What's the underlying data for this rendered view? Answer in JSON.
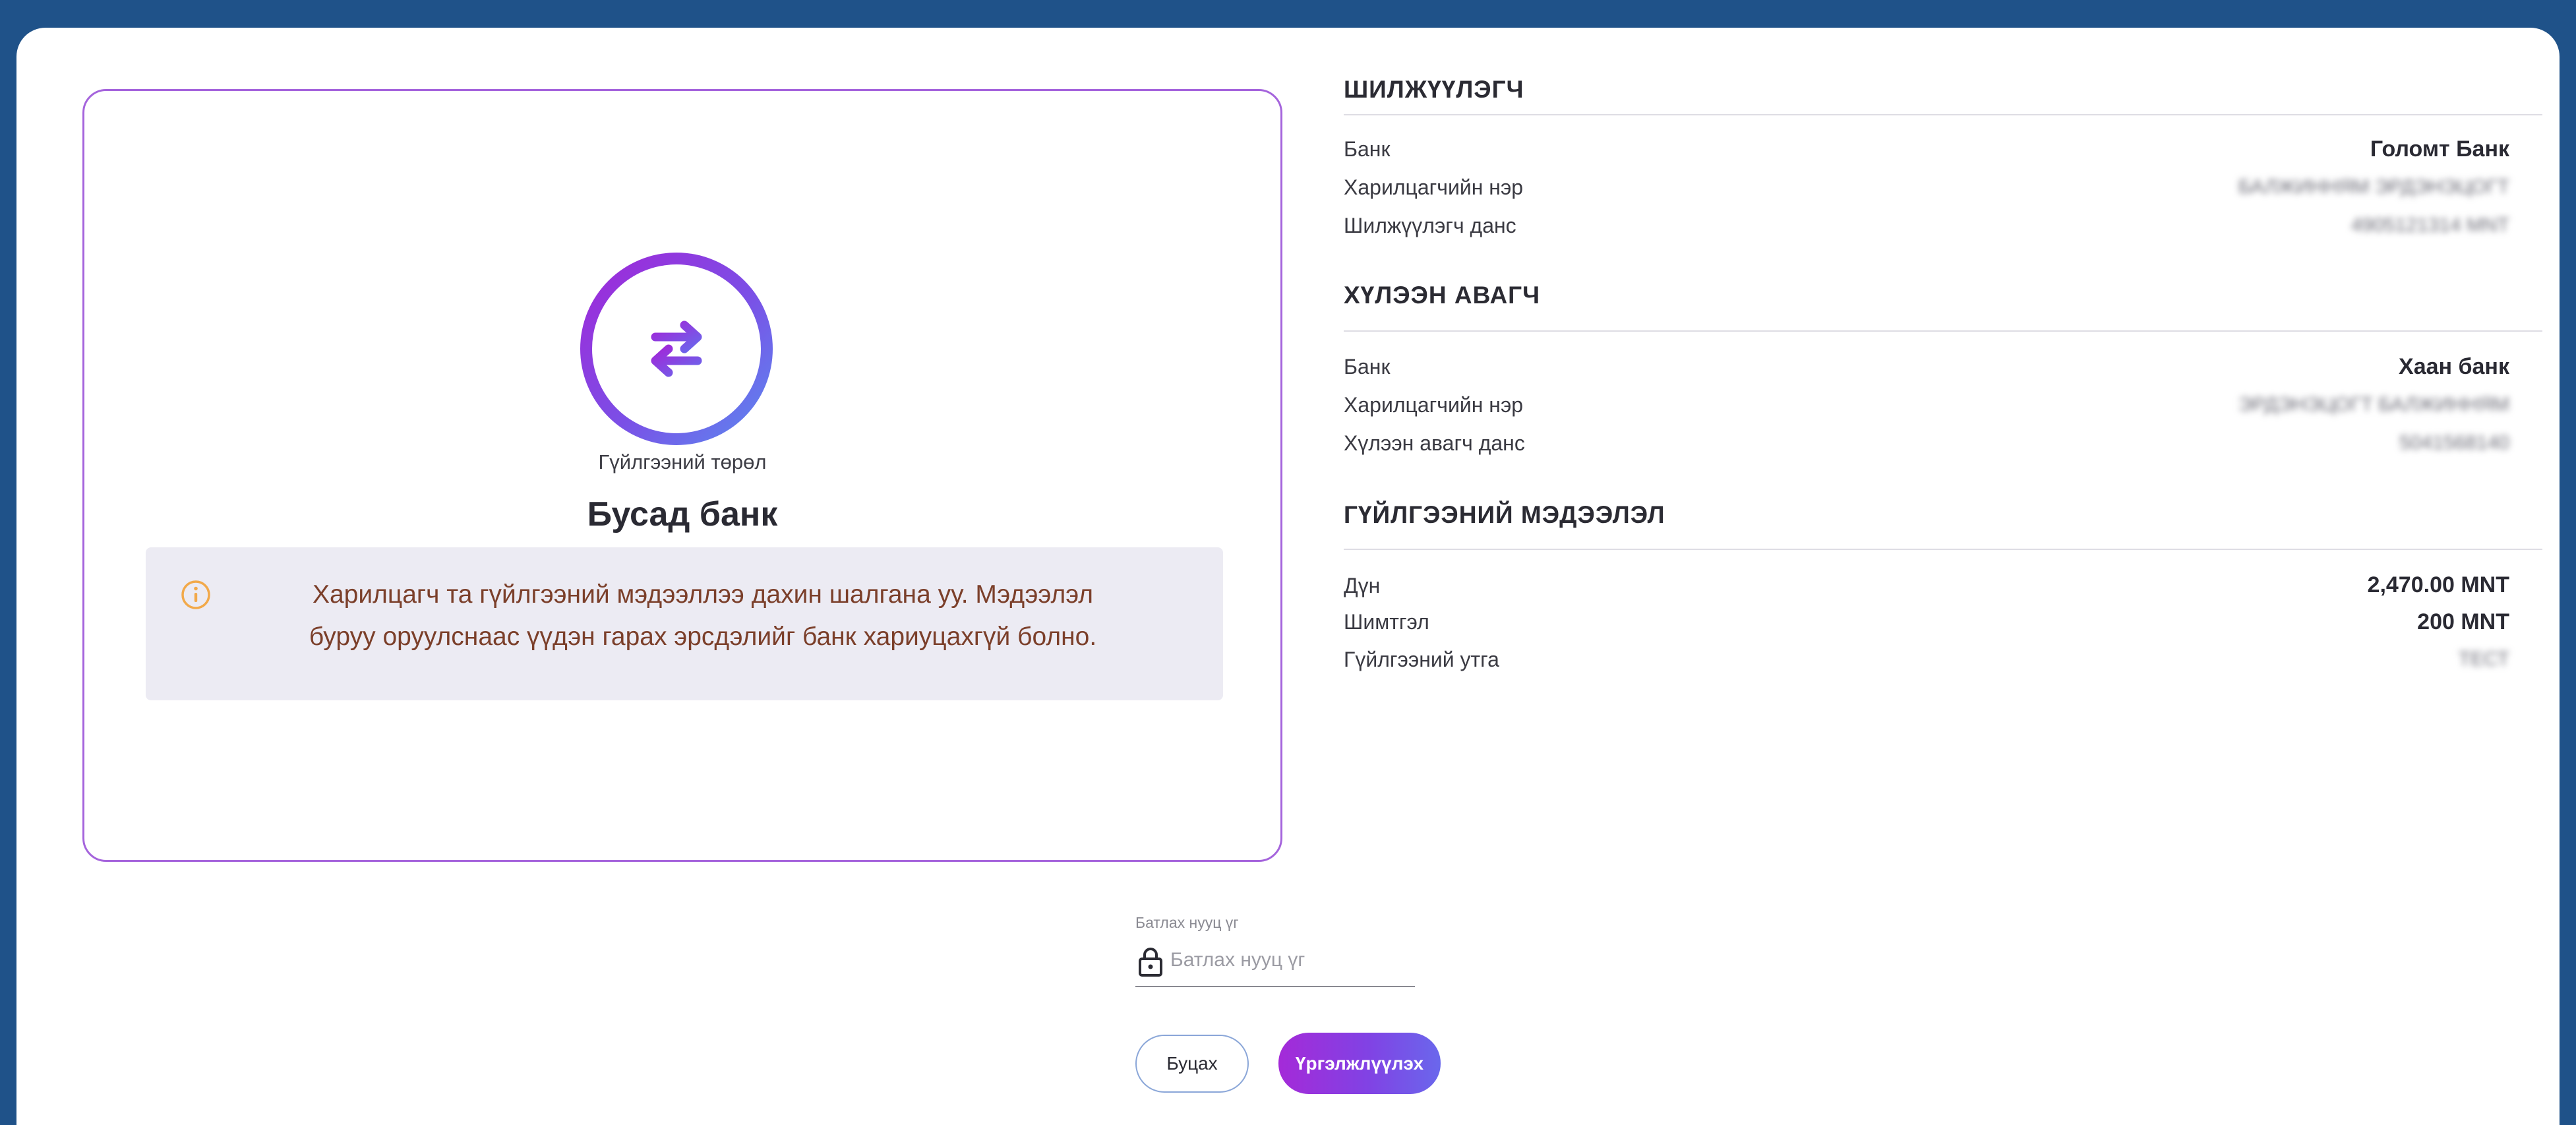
{
  "transaction_type": {
    "label": "Гүйлгээний төрөл",
    "value": "Бусад банк",
    "icon": "transfer-arrows-icon"
  },
  "notice": {
    "icon": "info-icon",
    "line1": "Харилцагч та гүйлгээний мэдээллээ дахин шалгана уу. Мэдээлэл",
    "line2": "буруу оруулснаас үүдэн гарах эрсдэлийг банк хариуцахгүй болно."
  },
  "sender": {
    "title": "ШИЛЖҮҮЛЭГЧ",
    "rows": [
      {
        "label": "Банк",
        "value": "Голомт Банк"
      },
      {
        "label": "Харилцагчийн нэр",
        "value": "БАЛЖИННЯМ ЭРДЭНЭЦОГТ"
      },
      {
        "label": "Шилжүүлэгч данс",
        "value": "4905121314 MNT"
      }
    ]
  },
  "receiver": {
    "title": "ХҮЛЭЭН АВАГЧ",
    "rows": [
      {
        "label": "Банк",
        "value": "Хаан банк"
      },
      {
        "label": "Харилцагчийн нэр",
        "value": "ЭРДЭНЭЦОГТ БАЛЖИННЯМ"
      },
      {
        "label": "Хүлээн авагч данс",
        "value": "5041568140"
      }
    ]
  },
  "transaction": {
    "title": "ГҮЙЛГЭЭНИЙ МЭДЭЭЛЭЛ",
    "rows": [
      {
        "label": "Дүн",
        "value": "2,470.00 MNT"
      },
      {
        "label": "Шимтгэл",
        "value": "200 MNT"
      },
      {
        "label": "Гүйлгээний утга",
        "value": "ТЕСТ"
      }
    ]
  },
  "password": {
    "label": "Батлах нууц үг",
    "placeholder": "Батлах нууц үг",
    "value": "",
    "icon": "lock-icon"
  },
  "buttons": {
    "back": "Буцах",
    "continue": "Үргэлжлүүлэх"
  },
  "colors": {
    "background": "#1f5289",
    "accent_purple": "#a226d8",
    "accent_blue": "#5a8cf0",
    "notice_background": "#ecebf3",
    "notice_text": "#7b3f2a",
    "info_icon": "#f2a94a"
  }
}
